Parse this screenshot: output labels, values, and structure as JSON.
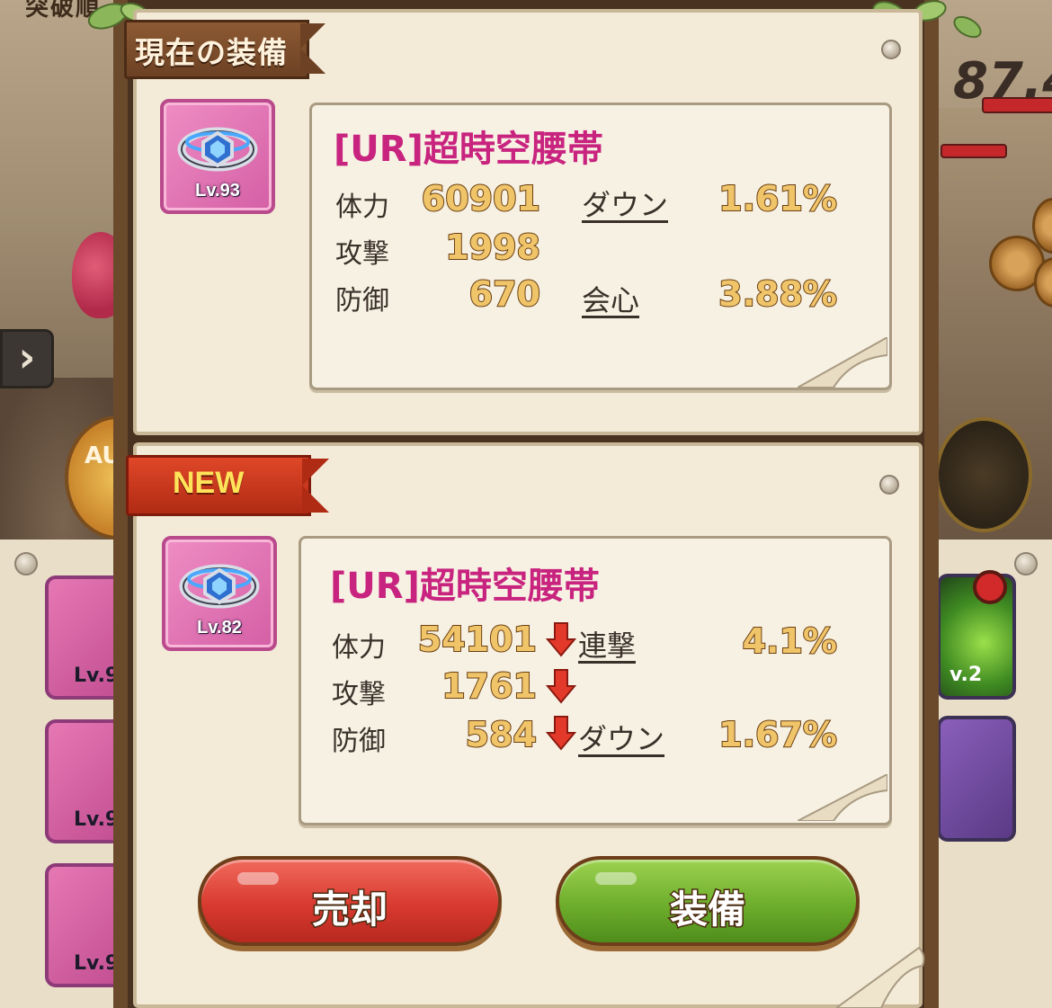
{
  "background": {
    "sort_label": "突破順",
    "score_partial": "87.4",
    "auto_label": "AU",
    "slot_levels_left": [
      "Lv.9",
      "Lv.9",
      "Lv.9"
    ],
    "slot_level_right": "v.2"
  },
  "current_equipment": {
    "header": "現在の装備",
    "item": {
      "level": "Lv.93",
      "name": "[UR]超時空腰帯",
      "icon": "belt-icon"
    },
    "stats": [
      {
        "label": "体力",
        "value": "60901"
      },
      {
        "label": "攻撃",
        "value": "1998"
      },
      {
        "label": "防御",
        "value": "670"
      }
    ],
    "sub_stats": [
      {
        "label": "ダウン",
        "value": "1.61%"
      },
      {
        "label": "会心",
        "value": "3.88%"
      }
    ]
  },
  "new_equipment": {
    "badge": "NEW",
    "item": {
      "level": "Lv.82",
      "name": "[UR]超時空腰帯",
      "icon": "belt-icon"
    },
    "stats": [
      {
        "label": "体力",
        "value": "54101",
        "trend": "down"
      },
      {
        "label": "攻撃",
        "value": "1761",
        "trend": "down"
      },
      {
        "label": "防御",
        "value": "584",
        "trend": "down"
      }
    ],
    "sub_stats": [
      {
        "label": "連撃",
        "value": "4.1%"
      },
      {
        "label": "ダウン",
        "value": "1.67%"
      }
    ]
  },
  "actions": {
    "sell_label": "売却",
    "equip_label": "装備"
  },
  "colors": {
    "item_name": "#c8247f",
    "stat_value": "#f0c56a",
    "sell_button": "#d93a30",
    "equip_button": "#6eae2c",
    "new_badge": "#e04728",
    "rarity_frame": "#d45fa5"
  }
}
